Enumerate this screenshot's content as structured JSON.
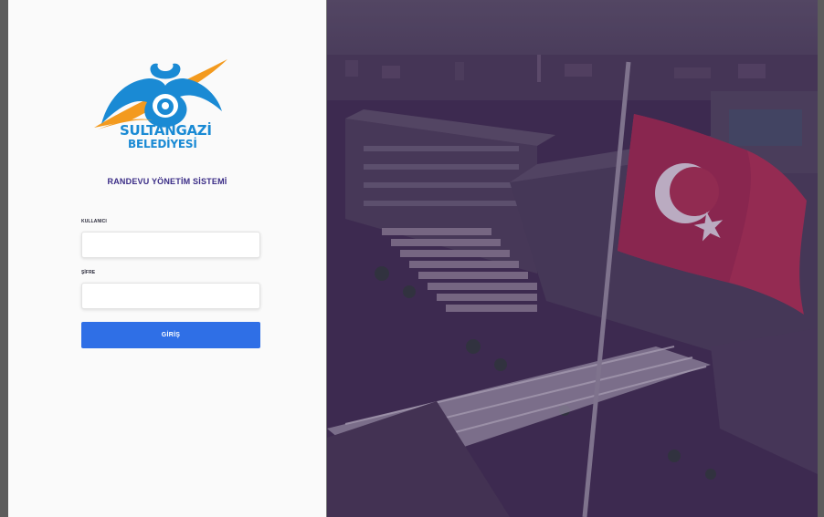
{
  "brand": {
    "name_line1": "SULTANGAZİ",
    "name_line2": "BELEDİYESİ",
    "logo_icon": "sultangazi-belediyesi-logo",
    "primary_color": "#1a8ad4",
    "accent_color": "#f39a1e"
  },
  "login": {
    "system_title": "RANDEVU YÖNETİM SİSTEMİ",
    "username_label": "KULLANICI",
    "username_value": "",
    "password_label": "ŞİFRE",
    "password_value": "",
    "submit_label": "GİRİŞ",
    "submit_color": "#2f6fe6"
  },
  "background": {
    "image_icon": "municipality-building-aerial-photo",
    "overlay_color": "#3a1f5c"
  }
}
